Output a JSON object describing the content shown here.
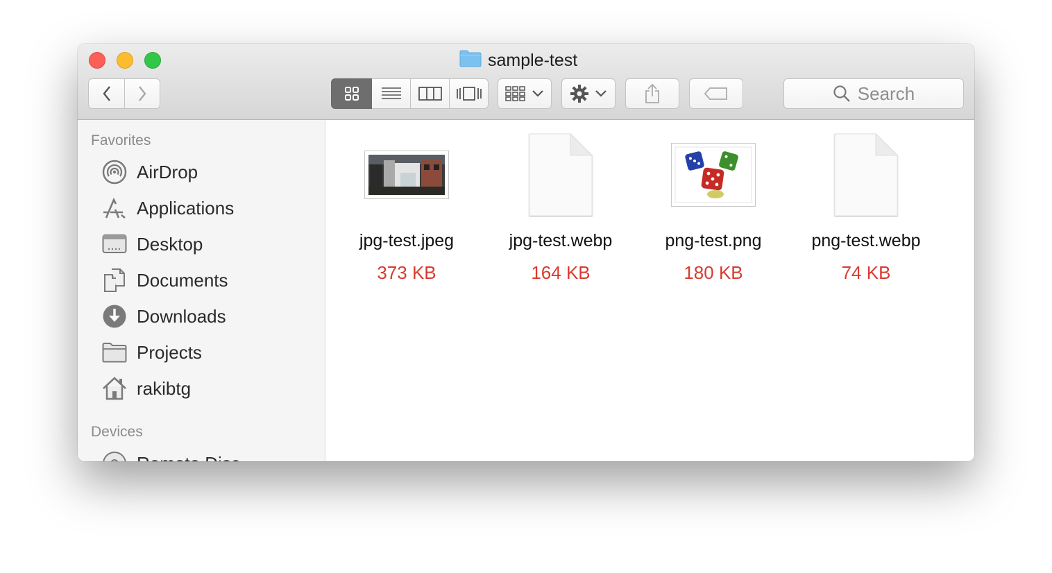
{
  "window": {
    "title": "sample-test"
  },
  "toolbar": {
    "search_placeholder": "Search",
    "view_modes": [
      "icon-view",
      "list-view",
      "column-view",
      "cover-flow-view"
    ]
  },
  "sidebar": {
    "favorites_heading": "Favorites",
    "favorites": [
      {
        "label": "AirDrop",
        "icon": "airdrop-icon"
      },
      {
        "label": "Applications",
        "icon": "applications-icon"
      },
      {
        "label": "Desktop",
        "icon": "desktop-icon"
      },
      {
        "label": "Documents",
        "icon": "documents-icon"
      },
      {
        "label": "Downloads",
        "icon": "downloads-icon"
      },
      {
        "label": "Projects",
        "icon": "folder-icon"
      },
      {
        "label": "rakibtg",
        "icon": "home-icon"
      }
    ],
    "devices_heading": "Devices",
    "devices": [
      {
        "label": "Remote Disc",
        "icon": "disc-icon"
      }
    ]
  },
  "files": [
    {
      "name": "jpg-test.jpeg",
      "size": "373 KB",
      "thumbnail": "photo-thumbnail"
    },
    {
      "name": "jpg-test.webp",
      "size": "164 KB",
      "thumbnail": "blank-document-icon"
    },
    {
      "name": "png-test.png",
      "size": "180 KB",
      "thumbnail": "dice-thumbnail"
    },
    {
      "name": "png-test.webp",
      "size": "74 KB",
      "thumbnail": "blank-document-icon"
    }
  ],
  "colors": {
    "size_label": "#d83a2e",
    "close": "#fc5f57",
    "minimize": "#fdbc2e",
    "maximize": "#33c748",
    "folder": "#7cc2f0"
  }
}
